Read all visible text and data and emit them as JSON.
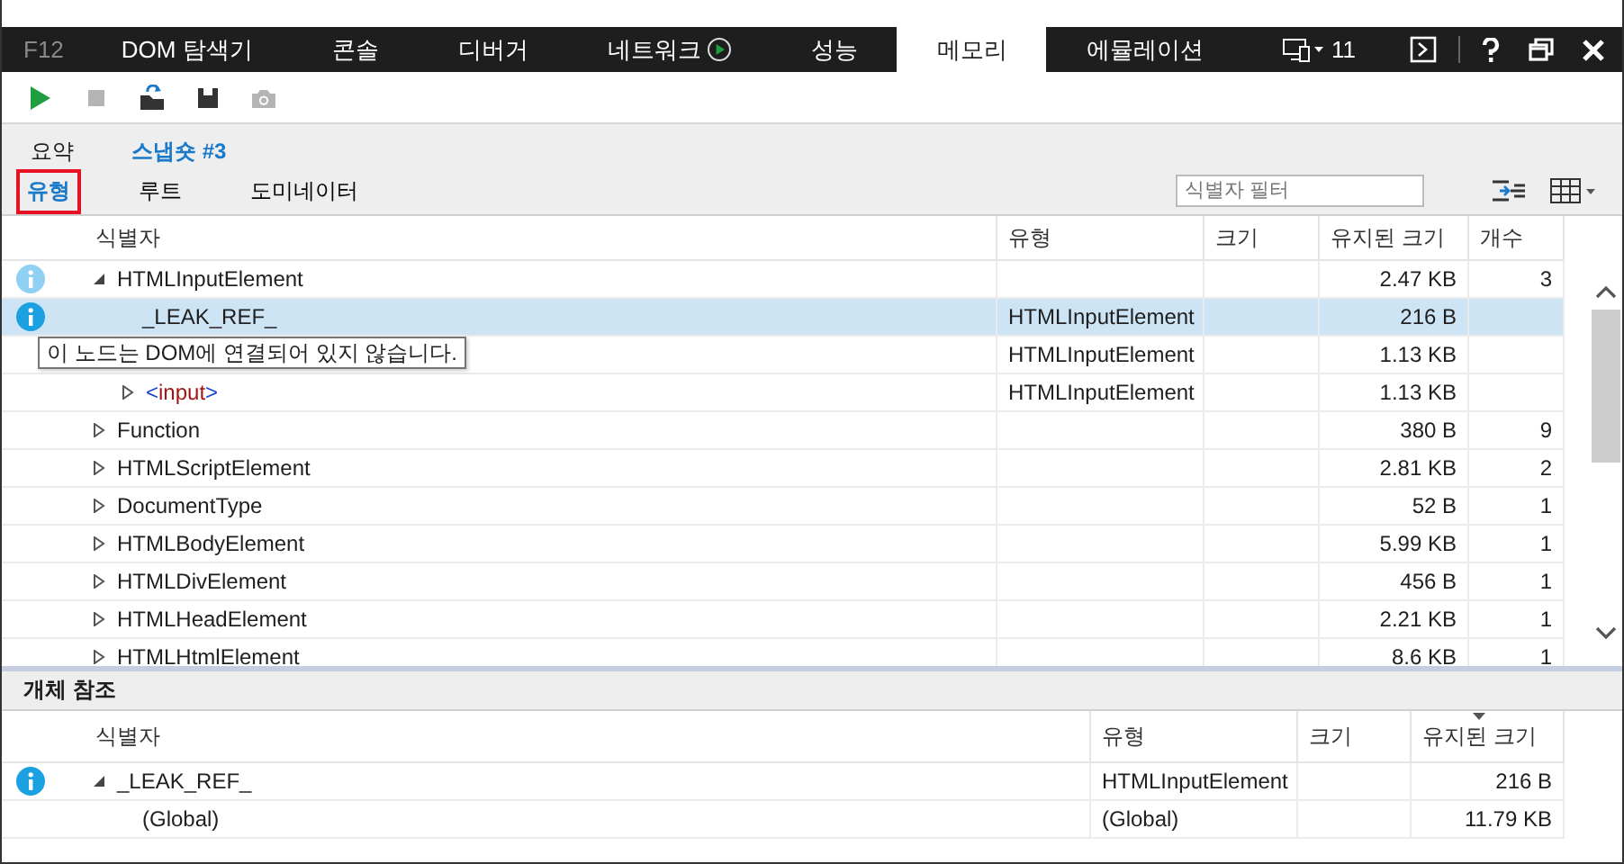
{
  "tabs": [
    {
      "label": "F12",
      "kind": "logo",
      "selected": false
    },
    {
      "label": "DOM 탐색기",
      "selected": false
    },
    {
      "label": "콘솔",
      "selected": false
    },
    {
      "label": "디버거",
      "selected": false
    },
    {
      "label": "네트워크",
      "kind": "recording",
      "selected": false
    },
    {
      "label": "성능",
      "selected": false
    },
    {
      "label": "메모리",
      "selected": true
    },
    {
      "label": "에뮬레이션",
      "selected": false
    }
  ],
  "title_bar": {
    "target_count": "11"
  },
  "toolbar": [
    {
      "kind": "start",
      "disabled": false
    },
    {
      "kind": "stop",
      "disabled": true
    },
    {
      "kind": "import",
      "disabled": false
    },
    {
      "kind": "save",
      "disabled": false
    },
    {
      "kind": "snapshot",
      "disabled": true
    }
  ],
  "breadcrumbs": [
    {
      "label": "요약",
      "selected": false
    },
    {
      "label": "스냅숏 #3",
      "selected": true
    }
  ],
  "views": [
    {
      "label": "유형",
      "selected": true
    },
    {
      "label": "루트",
      "selected": false
    },
    {
      "label": "도미네이터",
      "selected": false
    }
  ],
  "filter": {
    "placeholder": "식별자 필터"
  },
  "table": {
    "columns": [
      {
        "label": "식별자"
      },
      {
        "label": "유형"
      },
      {
        "label": "크기"
      },
      {
        "label": "유지된 크기"
      },
      {
        "label": "개수"
      }
    ],
    "rows": [
      {
        "identifier": "HTMLInputElement",
        "retained": "2.47 KB",
        "count": "3",
        "info": true,
        "info_active": false,
        "expanded": true,
        "selected": false,
        "children": [
          {
            "identifier": "_LEAK_REF_",
            "type": "HTMLInputElement",
            "retained": "216 B",
            "info": true,
            "info_active": true,
            "selected": true
          },
          {
            "type": "HTMLInputElement",
            "retained": "1.13 KB",
            "selected": false
          },
          {
            "tag_parts": [
              "<",
              "input",
              ">"
            ],
            "type": "HTMLInputElement",
            "retained": "1.13 KB",
            "expanded": false,
            "selected": false
          }
        ]
      },
      {
        "identifier": "Function",
        "retained": "380 B",
        "count": "9",
        "expanded": false,
        "selected": false
      },
      {
        "identifier": "HTMLScriptElement",
        "retained": "2.81 KB",
        "count": "2",
        "expanded": false,
        "selected": false
      },
      {
        "identifier": "DocumentType",
        "retained": "52 B",
        "count": "1",
        "expanded": false,
        "selected": false
      },
      {
        "identifier": "HTMLBodyElement",
        "retained": "5.99 KB",
        "count": "1",
        "expanded": false,
        "selected": false
      },
      {
        "identifier": "HTMLDivElement",
        "retained": "456 B",
        "count": "1",
        "expanded": false,
        "selected": false
      },
      {
        "identifier": "HTMLHeadElement",
        "retained": "2.21 KB",
        "count": "1",
        "expanded": false,
        "selected": false
      },
      {
        "identifier": "HTMLHtmlElement",
        "retained": "8.6 KB",
        "count": "1",
        "expanded": false,
        "selected": false
      }
    ]
  },
  "tooltip": "이 노드는 DOM에 연결되어 있지 않습니다.",
  "references": {
    "title": "개체 참조",
    "columns": [
      {
        "label": "식별자"
      },
      {
        "label": "유형"
      },
      {
        "label": "크기"
      },
      {
        "label": "유지된 크기",
        "sorted_descending": true
      }
    ],
    "rows": [
      {
        "identifier": "_LEAK_REF_",
        "type": "HTMLInputElement",
        "retained": "216 B",
        "info": true,
        "info_active": true,
        "expanded": true,
        "selected": false,
        "children": [
          {
            "identifier": "(Global)",
            "type": "(Global)",
            "retained": "11.79 KB",
            "selected": false
          }
        ]
      }
    ]
  }
}
